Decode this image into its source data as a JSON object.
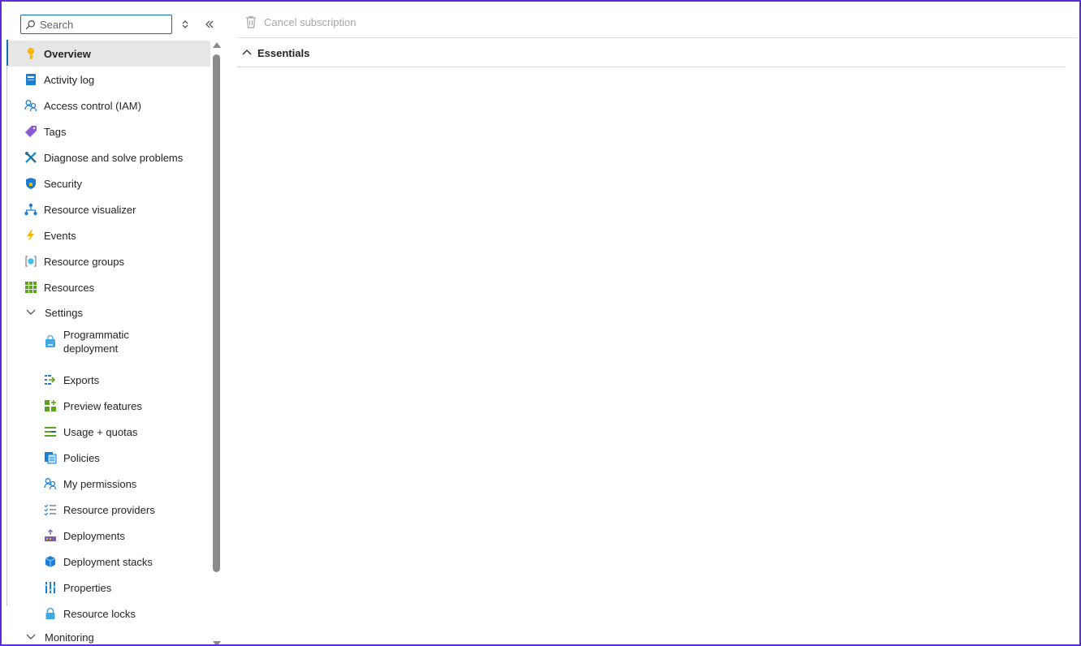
{
  "search": {
    "placeholder": "Search"
  },
  "toolbar": {
    "cancel_label": "Cancel subscription"
  },
  "essentials": {
    "label": "Essentials"
  },
  "menu": {
    "items": [
      {
        "label": "Overview",
        "icon": "key-icon"
      },
      {
        "label": "Activity log",
        "icon": "activity-log-icon"
      },
      {
        "label": "Access control (IAM)",
        "icon": "people-icon"
      },
      {
        "label": "Tags",
        "icon": "tag-icon"
      },
      {
        "label": "Diagnose and solve problems",
        "icon": "wrench-icon"
      },
      {
        "label": "Security",
        "icon": "shield-icon"
      },
      {
        "label": "Resource visualizer",
        "icon": "hierarchy-icon"
      },
      {
        "label": "Events",
        "icon": "lightning-icon"
      },
      {
        "label": "Resource groups",
        "icon": "resource-group-icon"
      },
      {
        "label": "Resources",
        "icon": "grid-icon"
      }
    ],
    "settings_label": "Settings",
    "settings_items": [
      {
        "label": "Programmatic deployment",
        "icon": "shopping-bag-icon"
      },
      {
        "label": "Exports",
        "icon": "export-icon"
      },
      {
        "label": "Preview features",
        "icon": "preview-icon"
      },
      {
        "label": "Usage + quotas",
        "icon": "quota-icon"
      },
      {
        "label": "Policies",
        "icon": "policy-icon"
      },
      {
        "label": "My permissions",
        "icon": "people-icon"
      },
      {
        "label": "Resource providers",
        "icon": "list-check-icon"
      },
      {
        "label": "Deployments",
        "icon": "deployment-icon"
      },
      {
        "label": "Deployment stacks",
        "icon": "cube-icon"
      },
      {
        "label": "Properties",
        "icon": "properties-icon"
      },
      {
        "label": "Resource locks",
        "icon": "lock-icon"
      }
    ],
    "monitoring_label": "Monitoring"
  },
  "colors": {
    "accent": "#0f6cbd",
    "frame": "#5b2be0",
    "active_bg": "#e6e6e6"
  }
}
